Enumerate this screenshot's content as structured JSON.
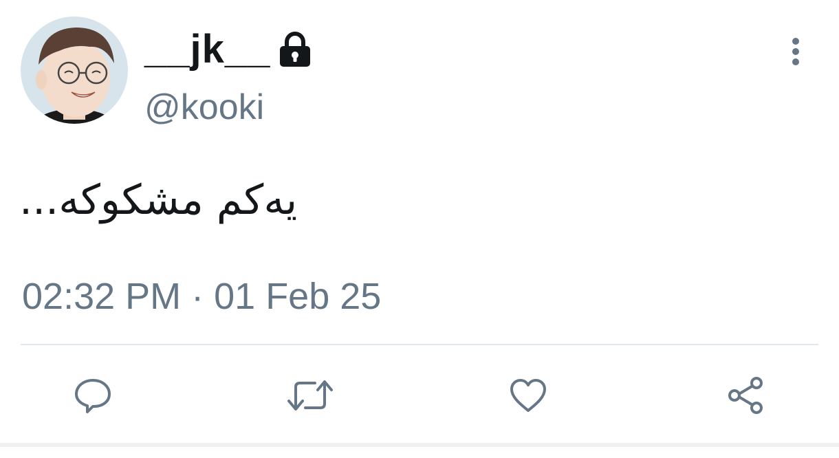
{
  "user": {
    "display_name": "__jk__",
    "handle": "@kooki",
    "protected_icon": "lock-icon",
    "avatar_icon": "avatar-photo"
  },
  "tweet": {
    "text": "یەکم مشکوکە...",
    "timestamp": "02:32 PM · 01 Feb 25"
  },
  "actions": [
    {
      "name": "reply",
      "icon": "speech-bubble-icon"
    },
    {
      "name": "retweet",
      "icon": "retweet-arrows-icon"
    },
    {
      "name": "like",
      "icon": "heart-icon"
    },
    {
      "name": "share",
      "icon": "share-icon"
    }
  ],
  "menu": {
    "icon": "vertical-dots-icon"
  },
  "colors": {
    "text_primary": "#14171a",
    "text_secondary": "#657786",
    "divider": "#e1e8ed"
  }
}
